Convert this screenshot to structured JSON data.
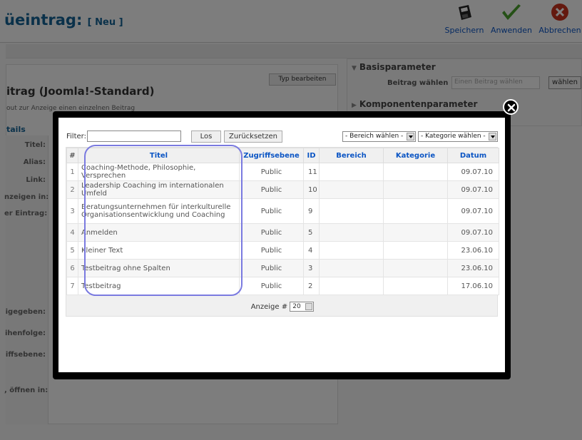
{
  "page": {
    "title": "üeintrag:",
    "title_suffix": "[ Neu ]"
  },
  "toolbar": {
    "save_label": "Speichern",
    "apply_label": "Anwenden",
    "cancel_label": "Abbrechen"
  },
  "editor": {
    "type_button_label": "Typ bearbeiten",
    "heading": "itrag (Joomla!-Standard)",
    "subtext": "out zur Anzeige einen einzelnen Beitrag",
    "details_label": "tails",
    "fields": {
      "title_label": "Titel:",
      "alias_label": "Alias:",
      "link_label": "Link:",
      "show_in_label": "nzeigen in:",
      "article_label": "er Eintrag:",
      "published_label": "igegeben:",
      "order_label": "ihenfolge:",
      "access_label": "iffsebene:",
      "open_in_label": ", öffnen in:"
    }
  },
  "params": {
    "basic_heading": "Basisparameter",
    "component_heading": "Komponentenparameter",
    "article_label": "Beitrag wählen",
    "article_placeholder": "Einen Beitrag wählen",
    "select_button_label": "wählen"
  },
  "modal": {
    "filter_label": "Filter:",
    "filter_value": "",
    "go_button_label": "Los",
    "reset_button_label": "Zurücksetzen",
    "section_select": "- Bereich wählen -",
    "category_select": "- Kategorie wählen -",
    "columns": [
      "#",
      "Titel",
      "Zugriffsebene",
      "ID",
      "Bereich",
      "Kategorie",
      "Datum"
    ],
    "rows": [
      {
        "num": "1",
        "title": "Coaching-Methode, Philosophie, Versprechen",
        "access": "Public",
        "id": "11",
        "section": "",
        "category": "",
        "date": "09.07.10"
      },
      {
        "num": "2",
        "title": "Leadership Coaching im internationalen Umfeld",
        "access": "Public",
        "id": "10",
        "section": "",
        "category": "",
        "date": "09.07.10"
      },
      {
        "num": "3",
        "title": "Beratungsunternehmen für interkulturelle Organisationsentwicklung und Coaching",
        "access": "Public",
        "id": "9",
        "section": "",
        "category": "",
        "date": "09.07.10"
      },
      {
        "num": "4",
        "title": "Anmelden",
        "access": "Public",
        "id": "5",
        "section": "",
        "category": "",
        "date": "09.07.10"
      },
      {
        "num": "5",
        "title": "Kleiner Text",
        "access": "Public",
        "id": "4",
        "section": "",
        "category": "",
        "date": "23.06.10"
      },
      {
        "num": "6",
        "title": "Testbeitrag ohne Spalten",
        "access": "Public",
        "id": "3",
        "section": "",
        "category": "",
        "date": "23.06.10"
      },
      {
        "num": "7",
        "title": "Testbeitrag",
        "access": "Public",
        "id": "2",
        "section": "",
        "category": "",
        "date": "17.06.10"
      }
    ],
    "pagination_label": "Anzeige #",
    "pagination_value": "20"
  },
  "colors": {
    "link_blue": "#0b55c4",
    "title_blue": "#146295",
    "annotation": "#7a7ae0"
  }
}
